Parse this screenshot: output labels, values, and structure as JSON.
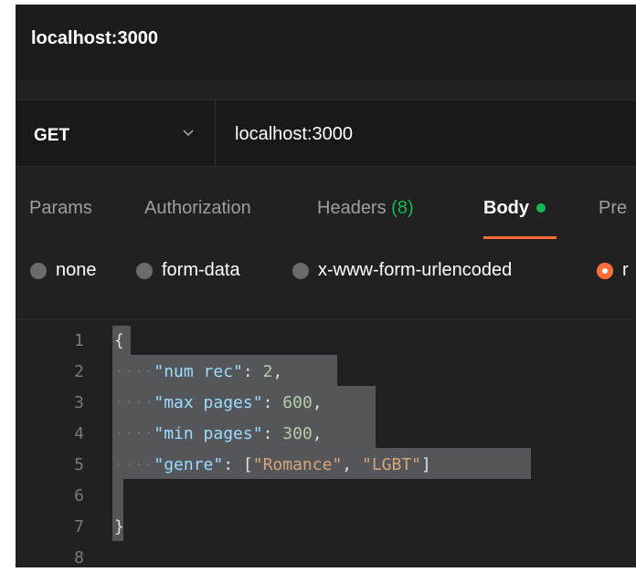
{
  "window": {
    "title": "localhost:3000"
  },
  "request": {
    "method": "GET",
    "url": "localhost:3000"
  },
  "tabs": [
    {
      "label": "Params"
    },
    {
      "label": "Authorization"
    },
    {
      "label": "Headers",
      "count": "(8)"
    },
    {
      "label": "Body",
      "active": true
    },
    {
      "label": "Pre"
    }
  ],
  "body_types": [
    {
      "label": "none"
    },
    {
      "label": "form-data"
    },
    {
      "label": "x-www-form-urlencoded"
    },
    {
      "label": "r",
      "selected": true
    }
  ],
  "editor": {
    "line_numbers": [
      "1",
      "2",
      "3",
      "4",
      "5",
      "6",
      "7",
      "8"
    ],
    "lines": [
      {
        "open": "{"
      },
      {
        "key": "\"num rec\"",
        "colon": ": ",
        "value": "2",
        "end": ","
      },
      {
        "key": "\"max pages\"",
        "colon": ": ",
        "value": "600",
        "end": ","
      },
      {
        "key": "\"min pages\"",
        "colon": ": ",
        "value": "300",
        "end": ","
      },
      {
        "key": "\"genre\"",
        "colon": ": ",
        "arr_open": "[",
        "item1": "\"Romance\"",
        "sep": ", ",
        "item2": "\"LGBT\"",
        "arr_close": "]"
      },
      {
        "blank": ""
      },
      {
        "close": "}"
      },
      {
        "blank": ""
      }
    ]
  },
  "colors": {
    "accent": "#ff6c37",
    "active_dot": "#0cbb52",
    "background": "#212121"
  }
}
